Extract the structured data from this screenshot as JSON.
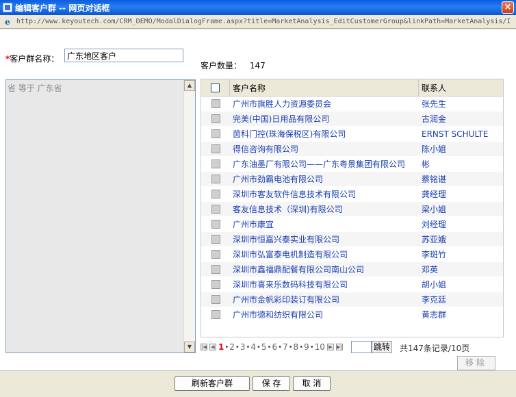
{
  "window": {
    "title": "编辑客户群 -- 网页对话框",
    "url": "http://www.keyoutech.com/CRM_DEMO/ModalDialogFrame.aspx?title=MarketAnalysis_EditCustomerGroup&linkPath=MarketAnalysis/I"
  },
  "form": {
    "required_mark": "*",
    "group_name_label": "客户群名称：",
    "group_name_value": "广东地区客户",
    "count_label": "客户数量：",
    "count_value": "147"
  },
  "criteria": {
    "text": "省 等于 广东省"
  },
  "grid": {
    "headers": {
      "name": "客户名称",
      "contact": "联系人"
    },
    "rows": [
      {
        "name": "广州市旗胜人力资源委员会",
        "contact": "张先生"
      },
      {
        "name": "完美(中国)日用品有限公司",
        "contact": "古润金"
      },
      {
        "name": "茵科门控(珠海保税区)有限公司",
        "contact": "ERNST SCHULTE"
      },
      {
        "name": "得信咨询有限公司",
        "contact": "陈小姐"
      },
      {
        "name": "广东油墨厂有限公司——广东粤景集团有限公司",
        "contact": "彬"
      },
      {
        "name": "广州市劲霸电池有限公司",
        "contact": "蔡铭谌"
      },
      {
        "name": "深圳市客友软件信息技术有限公司",
        "contact": "龚经理"
      },
      {
        "name": "客友信息技术（深圳)有限公司",
        "contact": "梁小姐"
      },
      {
        "name": "广州市康宜",
        "contact": "刘经理"
      },
      {
        "name": "深圳市恒嘉兴泰实业有限公司",
        "contact": "苏亚娥"
      },
      {
        "name": "深圳市弘富泰电机制造有限公司",
        "contact": "李斑竹"
      },
      {
        "name": "深圳市鑫福鼎配餐有限公司南山公司",
        "contact": "邓英"
      },
      {
        "name": "深圳市喜来乐数码科技有限公司",
        "contact": "胡小姐"
      },
      {
        "name": "广州市金帆彩印装订有限公司",
        "contact": "李克廷"
      },
      {
        "name": "广州市德和纺织有限公司",
        "contact": "黄志群"
      }
    ]
  },
  "pager": {
    "pages": [
      "1",
      "2",
      "3",
      "4",
      "5",
      "6",
      "7",
      "8",
      "9",
      "10"
    ],
    "current": "1",
    "separator": "•",
    "jump_label": "跳转",
    "total_text": "共147条记录/10页"
  },
  "buttons": {
    "remove": "移除",
    "refresh": "刷新客户群",
    "save": "保 存",
    "cancel": "取 消"
  },
  "colors": {
    "titlebar": "#0a5fe0",
    "link": "#1a3eb0",
    "current_page": "#ee0000"
  }
}
